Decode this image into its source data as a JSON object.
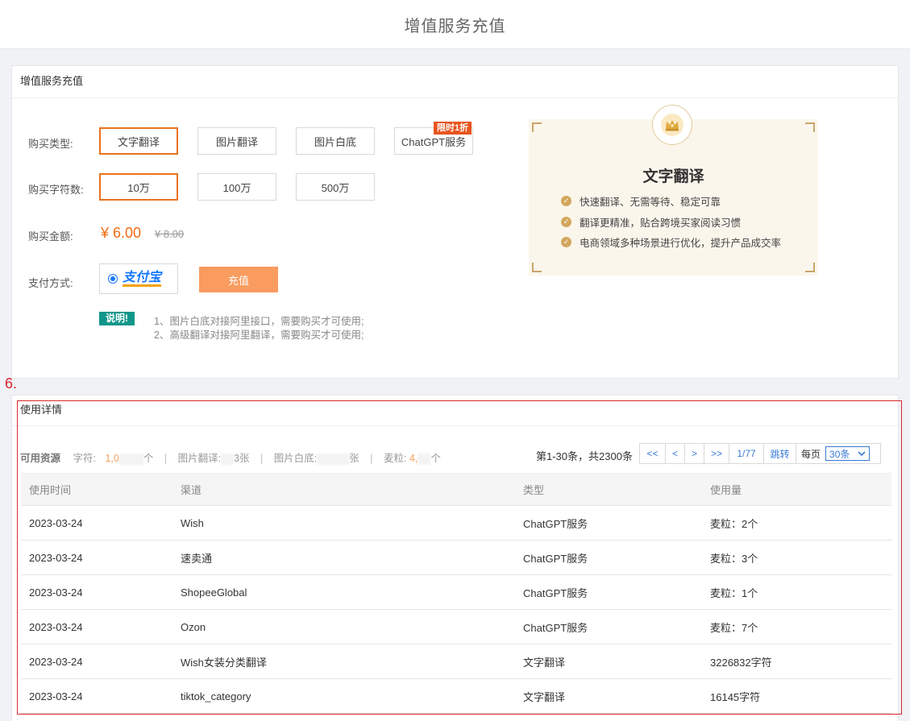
{
  "header": {
    "title": "增值服务充值"
  },
  "recharge_panel": {
    "title": "增值服务充值",
    "type_label": "购买类型:",
    "types": [
      {
        "label": "文字翻译",
        "active": true
      },
      {
        "label": "图片翻译",
        "active": false
      },
      {
        "label": "图片白底",
        "active": false
      },
      {
        "label": "ChatGPT服务",
        "active": false,
        "badge": "限时1折"
      }
    ],
    "count_label": "购买字符数:",
    "counts": [
      {
        "label": "10万",
        "active": true
      },
      {
        "label": "100万",
        "active": false
      },
      {
        "label": "500万",
        "active": false
      }
    ],
    "amount_label": "购买金额:",
    "price": "¥ 6.00",
    "old_price": "¥ 8.00",
    "pay_label": "支付方式:",
    "pay_method": "支付宝",
    "recharge_button": "充值",
    "note_tag": "说明!",
    "notes": [
      "1、图片白底对接阿里接口，需要购买才可使用;",
      "2、高级翻译对接阿里翻译，需要购买才可使用;"
    ]
  },
  "promo_card": {
    "icon": "crown-icon",
    "title": "文字翻译",
    "features": [
      "快速翻译、无需等待、稳定可靠",
      "翻译更精准，贴合跨境买家阅读习惯",
      "电商领域多种场景进行优化，提升产品成交率"
    ]
  },
  "annotation": {
    "step": "6."
  },
  "usage_panel": {
    "title": "使用详情",
    "resources": {
      "label": "可用资源",
      "chars_label": "字符:",
      "chars_value_start": "1,0",
      "chars_unit": "个",
      "img_trans_label": "图片翻译:",
      "img_trans_value_end": "3",
      "img_trans_unit": "张",
      "img_white_label": "图片白底:",
      "img_white_unit": "张",
      "grain_label": "麦粒:",
      "grain_value_start": "4,",
      "grain_unit": "个",
      "separator": "|"
    },
    "pagination": {
      "info": "第1-30条，共2300条",
      "first": "<<",
      "prev": "<",
      "next": ">",
      "last": ">>",
      "page": "1/77",
      "jump": "跳转",
      "per_page_label": "每页",
      "per_page_value": "30条"
    },
    "columns": [
      "使用时间",
      "渠道",
      "类型",
      "使用量"
    ],
    "rows": [
      [
        "2023-03-24",
        "Wish",
        "ChatGPT服务",
        "麦粒：2个"
      ],
      [
        "2023-03-24",
        "速卖通",
        "ChatGPT服务",
        "麦粒：3个"
      ],
      [
        "2023-03-24",
        "ShopeeGlobal",
        "ChatGPT服务",
        "麦粒：1个"
      ],
      [
        "2023-03-24",
        "Ozon",
        "ChatGPT服务",
        "麦粒：7个"
      ],
      [
        "2023-03-24",
        "Wish女装分类翻译",
        "文字翻译",
        "3226832字符"
      ],
      [
        "2023-03-24",
        "tiktok_category",
        "文字翻译",
        "16145字符"
      ]
    ]
  },
  "colors": {
    "accent": "#e8731e",
    "price": "#f26a11",
    "button": "#fa9b5f",
    "note": "#11968b",
    "highlight": "#d9262e",
    "link": "#3a7bd5",
    "gold": "#d2a75e"
  }
}
